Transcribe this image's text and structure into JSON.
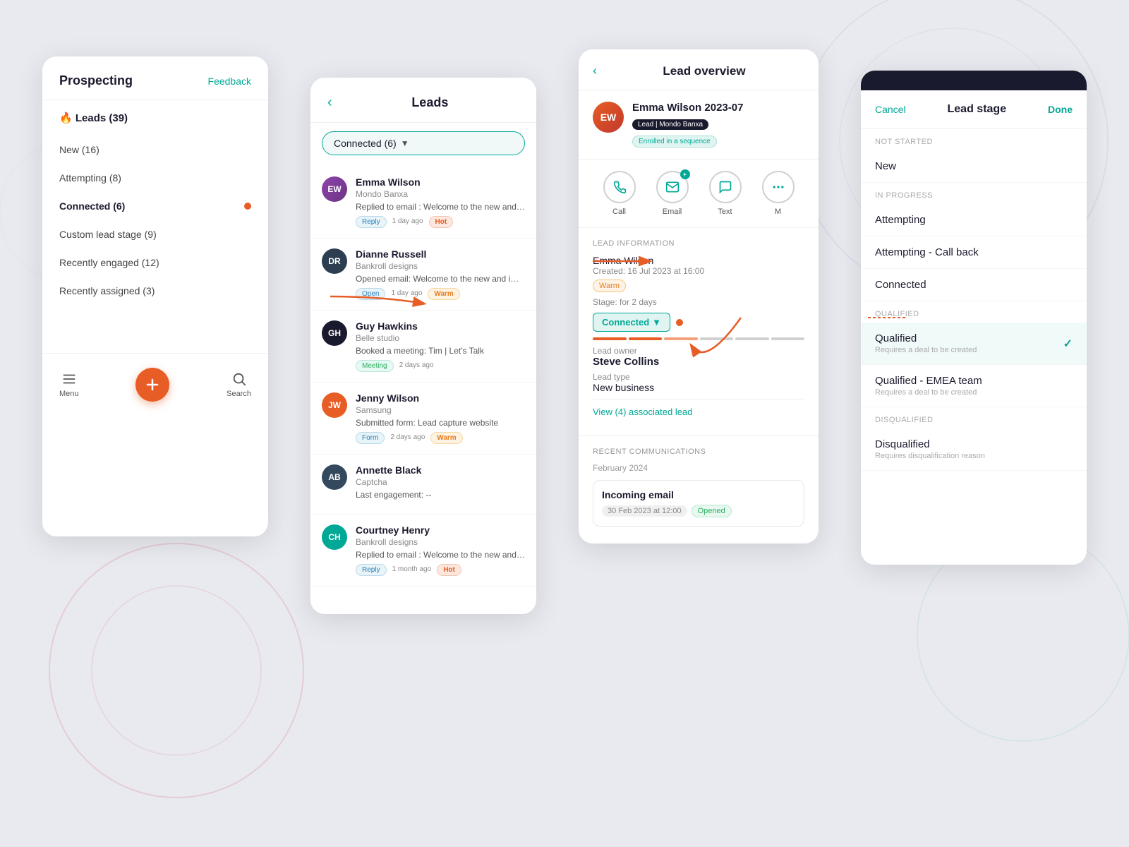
{
  "background": {
    "color": "#e8eaf0"
  },
  "prospecting_panel": {
    "title": "Prospecting",
    "feedback_label": "Feedback",
    "leads_section": "🔥 Leads (39)",
    "nav_items": [
      {
        "label": "New (16)",
        "active": false
      },
      {
        "label": "Attempting (8)",
        "active": false
      },
      {
        "label": "Connected (6)",
        "active": true,
        "has_dot": true
      },
      {
        "label": "Custom lead stage (9)",
        "active": false
      },
      {
        "label": "Recently engaged (12)",
        "active": false
      },
      {
        "label": "Recently assigned (3)",
        "active": false
      }
    ],
    "toolbar": {
      "menu_label": "Menu",
      "search_label": "Search"
    }
  },
  "leads_panel": {
    "title": "Leads",
    "back_label": "‹",
    "filter_label": "Connected (6)",
    "leads": [
      {
        "name": "Emma Wilson",
        "company": "Mondo Banxa",
        "activity": "Replied to email : Welcome to the new and im...",
        "tags": [
          "Reply",
          "1 day ago",
          "Hot"
        ],
        "avatar_color": "#9b59b6",
        "avatar_initials": "EW",
        "avatar_type": "color"
      },
      {
        "name": "Dianne Russell",
        "company": "Bankroll designs",
        "activity": "Opened email: Welcome to the new and impr...",
        "tags": [
          "Open",
          "1 day ago",
          "Warm"
        ],
        "avatar_color": "#2c3e50",
        "avatar_initials": "DR",
        "avatar_type": "color"
      },
      {
        "name": "Guy Hawkins",
        "company": "Belle studio",
        "activity": "Booked a meeting: Tim | Let's Talk",
        "tags": [
          "Meeting",
          "2 days ago"
        ],
        "avatar_color": "#1a1a2e",
        "avatar_initials": "GH",
        "avatar_type": "dark"
      },
      {
        "name": "Jenny Wilson",
        "company": "Samsung",
        "activity": "Submitted form: Lead capture website",
        "tags": [
          "Form",
          "2 days ago",
          "Warm"
        ],
        "avatar_color": "#e85d26",
        "avatar_initials": "JW",
        "avatar_type": "orange"
      },
      {
        "name": "Annette Black",
        "company": "Captcha",
        "activity": "Last engagement: --",
        "tags": [],
        "avatar_color": "#2c3e50",
        "avatar_initials": "AB",
        "avatar_type": "dark"
      },
      {
        "name": "Courtney Henry",
        "company": "Bankroll designs",
        "activity": "Replied to email : Welcome to the new and im...",
        "tags": [
          "Reply",
          "1 month ago",
          "Hot"
        ],
        "avatar_color": "#00a896",
        "avatar_initials": "CH",
        "avatar_type": "teal"
      }
    ]
  },
  "lead_overview_panel": {
    "title": "Lead overview",
    "back_label": "‹",
    "lead_name": "Emma Wilson 2023-07",
    "lead_badge": "Lead | Mondo Banxa",
    "enrolled_badge": "Enrolled in a sequence",
    "actions": [
      {
        "label": "Call",
        "icon": "📞"
      },
      {
        "label": "Email",
        "icon": "✉"
      },
      {
        "label": "Text",
        "icon": "💬"
      },
      {
        "label": "M",
        "icon": "⋯"
      }
    ],
    "lead_info_label": "Lead information",
    "lead_full_name": "Emma Wilson",
    "created_label": "Created: 16 Jul 2023 at 16:00",
    "temp_label": "Warm",
    "stage_label": "Stage: for 2 days",
    "stage_value": "Connected",
    "owner_label": "Lead owner",
    "owner_name": "Steve Collins",
    "lead_type_label": "Lead type",
    "lead_type_value": "New business",
    "view_associated": "View (4) associated lead",
    "comms_label": "Recent communications",
    "comms_month": "February 2024",
    "comm_title": "Incoming email",
    "comm_date": "30 Feb 2023 at 12:00",
    "comm_status": "Opened"
  },
  "lead_stage_panel": {
    "cancel_label": "Cancel",
    "title": "Lead stage",
    "done_label": "Done",
    "groups": [
      {
        "group_label": "Not started",
        "options": [
          {
            "label": "New",
            "sub": "",
            "selected": false
          }
        ]
      },
      {
        "group_label": "In progress",
        "options": [
          {
            "label": "Attempting",
            "sub": "",
            "selected": false
          },
          {
            "label": "Attempting - Call back",
            "sub": "",
            "selected": false
          },
          {
            "label": "Connected",
            "sub": "",
            "selected": false
          }
        ]
      },
      {
        "group_label": "Qualified",
        "options": [
          {
            "label": "Qualified",
            "sub": "Requires a deal to be created",
            "selected": true
          },
          {
            "label": "Qualified - EMEA team",
            "sub": "Requires a deal to be created",
            "selected": false
          }
        ]
      },
      {
        "group_label": "Disqualified",
        "options": [
          {
            "label": "Disqualified",
            "sub": "Requires disqualification reason",
            "selected": false
          }
        ]
      }
    ]
  }
}
